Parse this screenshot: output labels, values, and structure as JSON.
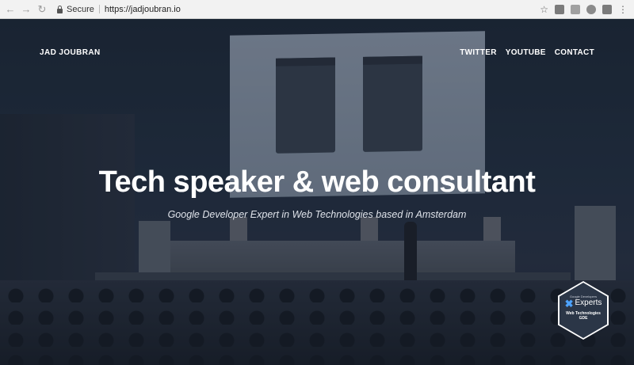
{
  "browser": {
    "secure_label": "Secure",
    "url": "https://jadjoubran.io"
  },
  "site": {
    "brand": "JAD JOUBRAN",
    "nav": [
      {
        "label": "TWITTER"
      },
      {
        "label": "YOUTUBE"
      },
      {
        "label": "CONTACT"
      }
    ],
    "headline": "Tech speaker & web consultant",
    "subline": "Google Developer Expert in Web Technologies based in Amsterdam"
  },
  "badge": {
    "top": "Google Developers",
    "word": "Experts",
    "category": "Web Technologies",
    "program": "GDE"
  },
  "colors": {
    "accent": "#4da3ff",
    "hero_text": "#ffffff"
  },
  "icons": {
    "back": "back-arrow-icon",
    "forward": "forward-arrow-icon",
    "reload": "reload-icon",
    "lock": "lock-icon",
    "star": "star-icon",
    "menu": "vertical-dots-icon"
  }
}
